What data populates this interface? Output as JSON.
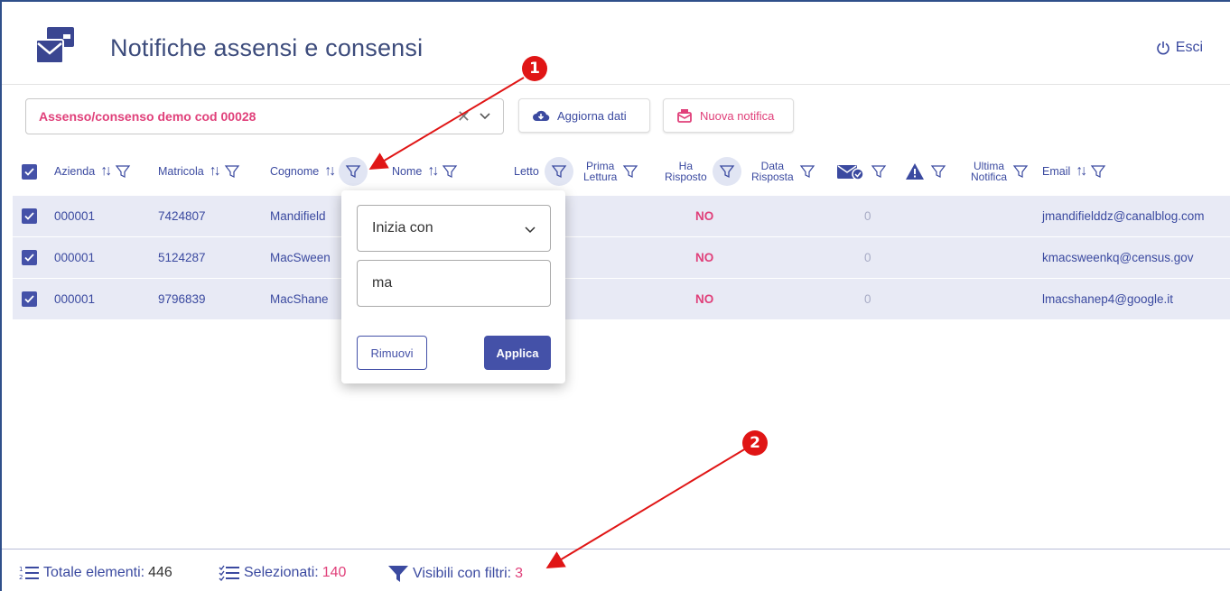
{
  "header": {
    "title": "Notifiche assensi e consensi",
    "logout_label": "Esci"
  },
  "toolbar": {
    "select_value": "Assenso/consenso demo cod 00028",
    "refresh_label": "Aggiorna dati",
    "new_label": "Nuova notifica"
  },
  "columns": {
    "azienda": "Azienda",
    "matricola": "Matricola",
    "cognome": "Cognome",
    "nome": "Nome",
    "letto": "Letto",
    "prima_lettura_1": "Prima",
    "prima_lettura_2": "Lettura",
    "ha_risposto_1": "Ha",
    "ha_risposto_2": "Risposto",
    "data_risposta_1": "Data",
    "data_risposta_2": "Risposta",
    "ultima_notifica_1": "Ultima",
    "ultima_notifica_2": "Notifica",
    "email": "Email"
  },
  "rows": [
    {
      "azienda": "000001",
      "matricola": "7424807",
      "cognome": "Mandifield",
      "ha_risposto": "NO",
      "count": "0",
      "email": "jmandifielddz@canalblog.com"
    },
    {
      "azienda": "000001",
      "matricola": "5124287",
      "cognome": "MacSween",
      "ha_risposto": "NO",
      "count": "0",
      "email": "kmacsweenkq@census.gov"
    },
    {
      "azienda": "000001",
      "matricola": "9796839",
      "cognome": "MacShane",
      "ha_risposto": "NO",
      "count": "0",
      "email": "lmacshanep4@google.it"
    }
  ],
  "filter_popup": {
    "mode": "Inizia con",
    "value": "ma",
    "remove_label": "Rimuovi",
    "apply_label": "Applica"
  },
  "footer": {
    "total_label": "Totale elementi:",
    "total_value": "446",
    "selected_label": "Selezionati:",
    "selected_value": "140",
    "visible_label": "Visibili con filtri:",
    "visible_value": "3"
  },
  "annotations": {
    "badge_1": "1",
    "badge_2": "2"
  },
  "colors": {
    "primary": "#4451a8",
    "accent": "#e0407a",
    "annotation": "#e01515"
  }
}
